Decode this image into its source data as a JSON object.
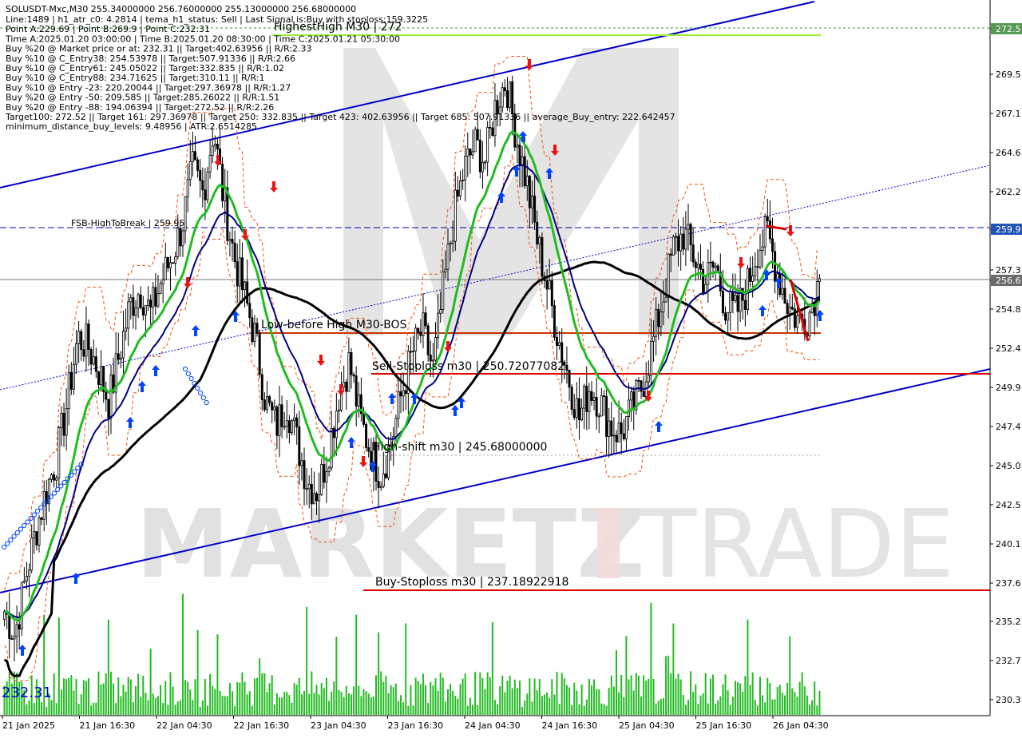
{
  "header": {
    "symbol_line": "SOLUSDT-Mxc,M30  255.34000000 256.76000000 255.13000000 256.68000000",
    "info_lines": [
      "Line:1489 | h1_atr_c0: 4.2814 | tema_h1_status: Sell | Last Signal is:Buy with stoploss:159.3225",
      "Point A:229.69 | Point B:269.9 | Point C:232.31",
      "Time A:2025.01.20 03:00:00 | Time B:2025.01.20 08:30:00 | Time C:2025.01.21 05:30:00",
      "Buy %20 @ Market price or at: 232.31 || Target:402.63956 || R/R:2.33",
      "Buy %10 @ C_Entry38: 254.53978 || Target:507.91336 || R/R:2.66",
      "Buy %10 @ C_Entry61: 245.05022 || Target:332.835 || R/R:1.02",
      "Buy %10 @ C_Entry88: 234.71625 || Target:310.11 || R/R:1",
      "Buy %10 @ Entry -23: 220.20044 || Target:297.36978 || R/R:1.27",
      "Buy %20 @ Entry -50: 209.585 || Target:285.26022 || R/R:1.51",
      "Buy %20 @ Entry -88: 194.06394 || Target:272.52 || R/R:2.26",
      "Target100: 272.52 || Target 161: 297.36978 || Target 250: 332.835 || Target 423: 402.63956 || Target 685: 507.91336 || average_Buy_entry: 222.642457",
      "minimum_distance_buy_levels: 9.48956 | ATR:2.6514285"
    ]
  },
  "watermark": {
    "left": "MARKETZ",
    "right": "TRADE"
  },
  "annotations": {
    "highest_high": "HighestHigh   M30 | 272",
    "fsb": "FSB-HighToBreak | 259.95",
    "low_before_high": "Low-before High   M30-BOS",
    "sell_stoploss": "Sell-Stoploss m30 | 250.72077082",
    "high_shift": "High-shift m30 | 245.68000000",
    "buy_stoploss": "Buy-Stoploss m30 | 237.18922918",
    "point_c_label": "232.31"
  },
  "colors": {
    "background": "#ffffff",
    "channel": "#0000cc",
    "ma_slow": "#000000",
    "ma_mid": "#000080",
    "ma_fast": "#22bb22",
    "highest_high_line": "#99ee33",
    "stoploss_line": "#dd0000",
    "low_before_line": "#cc3300",
    "fsb_line": "#0000aa",
    "volume": "#22bb22",
    "buy_arrow": "#0044ff",
    "sell_arrow": "#ee1111",
    "price_tag_bg": "#6b6b6b",
    "level_tag_blue": "#2255bb",
    "level_tag_green": "#559955"
  },
  "price_axis": {
    "ticks": [
      "272.5",
      "269.5",
      "267.1",
      "264.6",
      "262.2",
      "259.9",
      "257.3",
      "256.6",
      "254.8",
      "252.4",
      "249.9",
      "247.4",
      "245.0",
      "242.5",
      "240.1",
      "237.6",
      "235.2",
      "232.7",
      "230.3"
    ],
    "current_price_tag": "256.6",
    "fsb_tag": "259.9",
    "highest_tag": "272.5"
  },
  "time_axis": {
    "ticks": [
      "21 Jan 2025",
      "21 Jan 16:30",
      "22 Jan 04:30",
      "22 Jan 16:30",
      "23 Jan 04:30",
      "23 Jan 16:30",
      "24 Jan 04:30",
      "24 Jan 16:30",
      "25 Jan 04:30",
      "25 Jan 16:30",
      "26 Jan 04:30"
    ]
  },
  "chart_data": {
    "type": "candlestick",
    "symbol": "SOLUSDT-Mxc",
    "timeframe": "M30",
    "ohlc_last": {
      "open": 255.34,
      "high": 256.76,
      "low": 255.13,
      "close": 256.68
    },
    "ylim": [
      229.5,
      274
    ],
    "levels": {
      "highest_high": 272,
      "fsb_high_to_break": 259.95,
      "low_before_high": 253.4,
      "sell_stoploss": 250.72077082,
      "high_shift": 245.68,
      "buy_stoploss": 237.18922918
    },
    "points": {
      "A": 229.69,
      "B": 269.9,
      "C": 232.31
    },
    "approx_close_path": [
      236.0,
      234.5,
      238.0,
      241.0,
      243.5,
      245.5,
      249.0,
      253.0,
      252.5,
      251.0,
      249.0,
      252.0,
      255.0,
      256.0,
      254.5,
      256.5,
      258.0,
      260.0,
      263.5,
      262.0,
      266.0,
      261.5,
      258.0,
      255.5,
      253.0,
      249.0,
      247.5,
      249.0,
      246.5,
      244.0,
      243.5,
      246.0,
      249.5,
      251.5,
      248.0,
      246.0,
      244.5,
      246.5,
      249.5,
      252.0,
      253.5,
      251.0,
      256.0,
      260.5,
      263.5,
      265.0,
      264.0,
      267.5,
      269.0,
      265.5,
      262.5,
      259.0,
      256.0,
      253.0,
      250.5,
      248.0,
      250.0,
      249.0,
      247.5,
      247.0,
      248.5,
      250.0,
      252.5,
      255.5,
      258.5,
      259.5,
      258.0,
      256.5,
      257.5,
      255.0,
      254.5,
      256.0,
      258.5,
      259.5,
      257.0,
      255.0,
      254.0,
      254.5,
      256.7
    ]
  }
}
